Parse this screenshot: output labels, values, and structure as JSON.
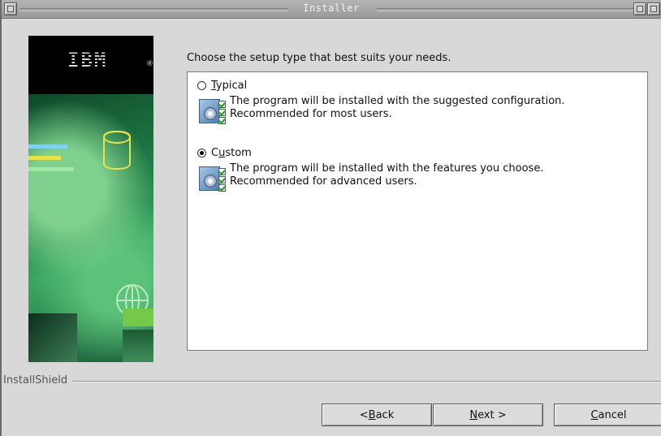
{
  "window": {
    "title": "Installer"
  },
  "branding": {
    "logo_text": "IBM",
    "footer_label": "InstallShield"
  },
  "main": {
    "heading": "Choose the setup type that best suits your needs.",
    "options": [
      {
        "label_pre": "",
        "label_mnemonic": "T",
        "label_post": "ypical",
        "checked": false,
        "line1": "The program will be installed with the suggested configuration.",
        "line2": "Recommended for most users.",
        "icon": "setup-icon"
      },
      {
        "label_pre": "C",
        "label_mnemonic": "u",
        "label_post": "stom",
        "checked": true,
        "line1": "The program will be installed with the features you choose.",
        "line2": "Recommended for advanced users.",
        "icon": "setup-icon"
      }
    ]
  },
  "buttons": {
    "back": {
      "pre": "< ",
      "mnemonic": "B",
      "post": "ack"
    },
    "next": {
      "pre": "",
      "mnemonic": "N",
      "post": "ext >"
    },
    "cancel": {
      "pre": "",
      "mnemonic": "C",
      "post": "ancel"
    }
  }
}
